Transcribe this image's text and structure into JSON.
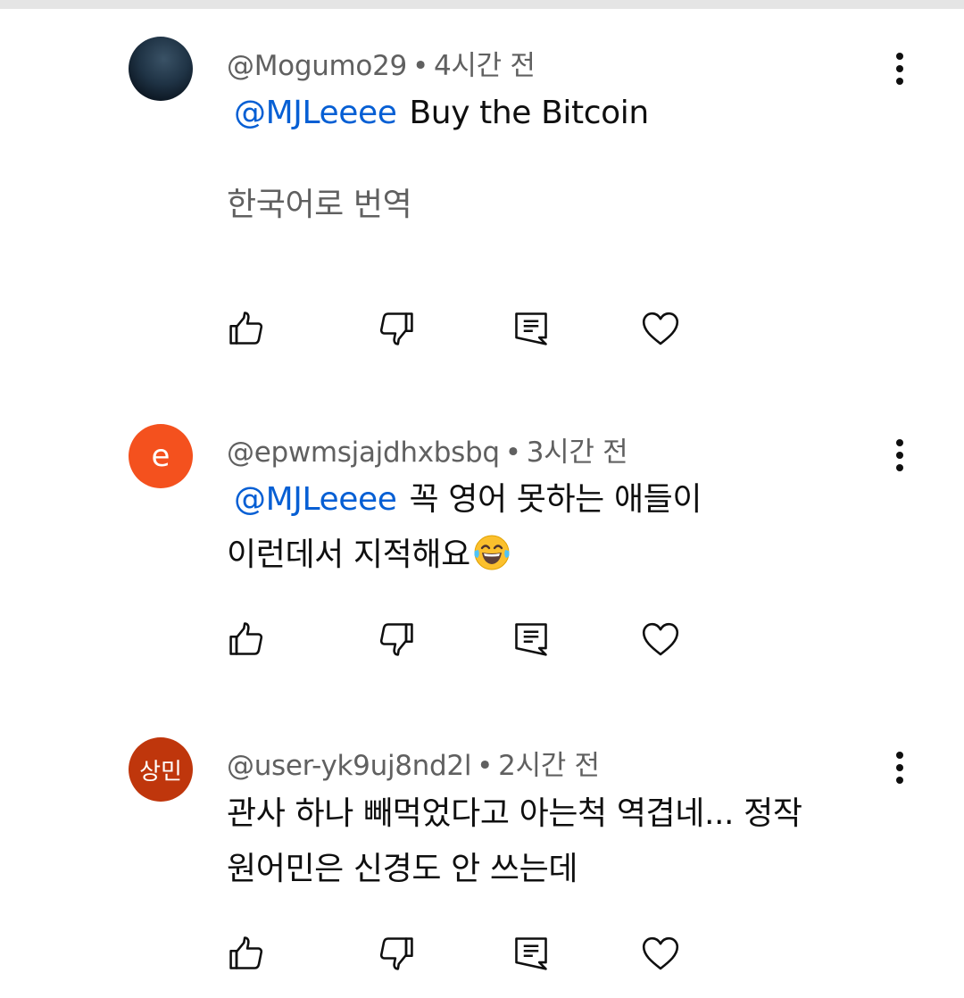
{
  "comments": [
    {
      "author": "@Mogumo29",
      "time": "4시간 전",
      "mention": "@MJLeeee",
      "text": "Buy the Bitcoin",
      "translate_label": "한국어로 번역",
      "avatar": "photo"
    },
    {
      "author": "@epwmsjajdhxbsbq",
      "time": "3시간 전",
      "mention": "@MJLeeee",
      "text_line1": "꼭 영어 못하는 애들이",
      "text_line2": "이런데서  지적해요",
      "emoji": "tears-of-joy-emoji",
      "avatar_letter": "e",
      "avatar_color": "#f4511e"
    },
    {
      "author": "@user-yk9uj8nd2l",
      "time": "2시간 전",
      "text_line1": "관사 하나 빼먹었다고 아는척 역겹네... 정작",
      "text_line2": "원어민은 신경도 안 쓰는데",
      "avatar_letter": "상민",
      "avatar_color": "#bf360c"
    }
  ],
  "separator": "•",
  "icons": {
    "like": "thumbs-up-icon",
    "dislike": "thumbs-down-icon",
    "reply": "reply-icon",
    "heart": "heart-icon",
    "more": "more-vert-icon"
  },
  "colors": {
    "mention": "#065fd4",
    "meta": "#606060",
    "text": "#0f0f0f"
  }
}
